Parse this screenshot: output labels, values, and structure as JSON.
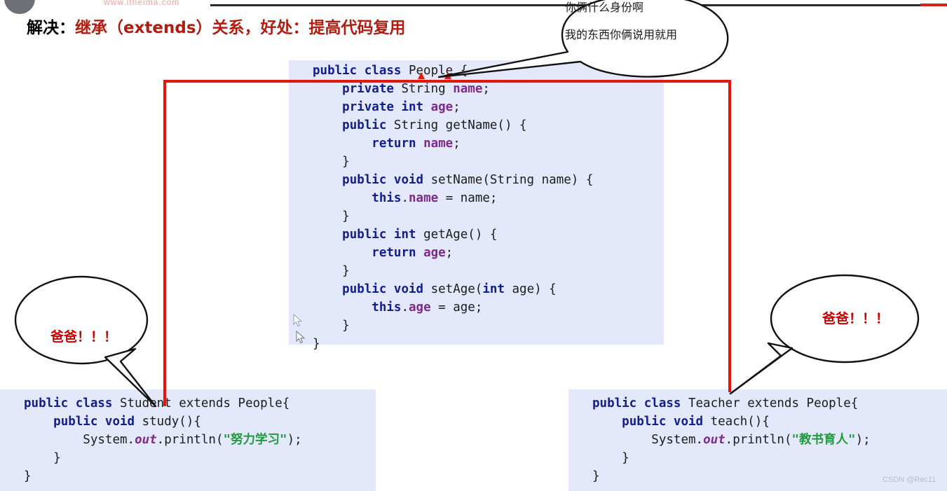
{
  "top_bar": {
    "url_text": "www.itheima.com",
    "logo": "circle-logo"
  },
  "heading": {
    "prefix": "解决：",
    "emphasis": "继承（extends）关系，好处：提高代码复用"
  },
  "code_blocks": {
    "people": {
      "title": "People",
      "lines": [
        "public class People {",
        "    private String name;",
        "    private int age;",
        "    public String getName() {",
        "        return name;",
        "    }",
        "    public void setName(String name) {",
        "        this.name = name;",
        "    }",
        "    public int getAge() {",
        "        return age;",
        "    }",
        "    public void setAge(int age) {",
        "        this.age = age;",
        "    }",
        "}"
      ]
    },
    "student": {
      "title": "Student",
      "lines": [
        "public class Student extends People{",
        "    public void study(){",
        "        System.out.println(\"努力学习\");",
        "    }",
        "}"
      ],
      "string_literal": "努力学习"
    },
    "teacher": {
      "title": "Teacher",
      "lines": [
        "public class Teacher extends People{",
        "    public void teach(){",
        "        System.out.println(\"教书育人\");",
        "    }",
        "}"
      ],
      "string_literal": "教书育人"
    }
  },
  "bubbles": {
    "top_right_line1": "你俩什么身份啊",
    "top_right_line2": "我的东西你俩说用就用",
    "left": "爸爸！！！",
    "right": "爸爸！！！"
  },
  "colors": {
    "code_background": "#e4e8fb",
    "keyword": "#111e8f",
    "field": "#7d2a8c",
    "string": "#1f9a3c",
    "annotation_red": "#e8150c",
    "heading_red": "#b01c10",
    "bubble_red": "#cc0000"
  },
  "watermark": "CSDN @Rec11"
}
